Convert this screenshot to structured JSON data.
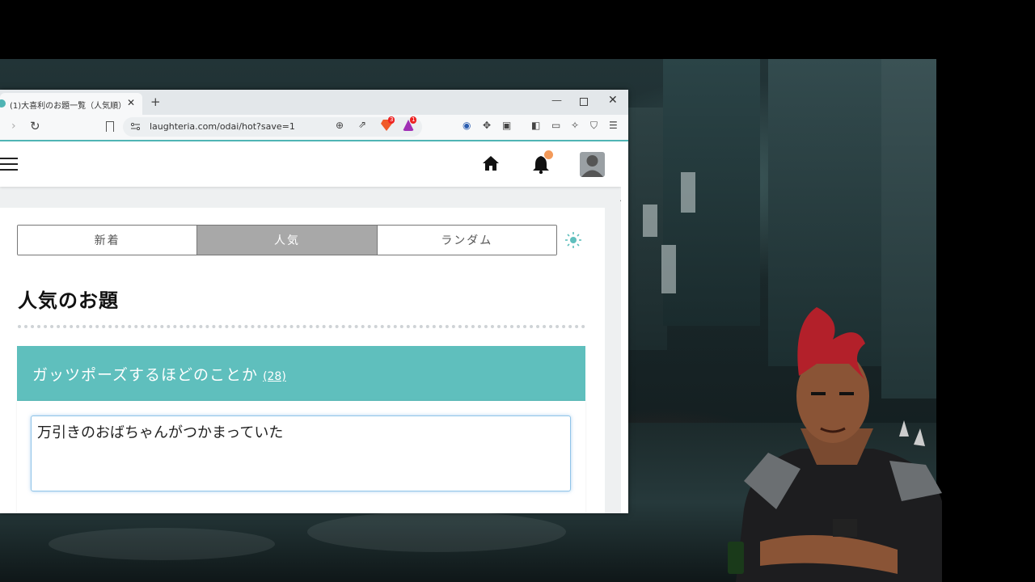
{
  "browser": {
    "tab_title": "(1)大喜利のお題一覧（人気順）",
    "tab_close": "✕",
    "new_tab": "+",
    "url": "laughteria.com/odai/hot?save=1",
    "brave_badge": "3",
    "rewards_badge": "1"
  },
  "site": {
    "nav_tabs": [
      "新着",
      "人気",
      "ランダム"
    ],
    "active_tab": "人気",
    "section_title": "人気のお題",
    "odai": {
      "title": "ガッツポーズするほどのことか",
      "count": "(28)"
    },
    "answer_value": "万引きのおばちゃんがつかまっていた"
  },
  "colors": {
    "accent": "#5fbfbd",
    "active_tab_bg": "#a8a8a8",
    "notification_dot": "#f39a5a"
  },
  "icons": [
    "menu-icon",
    "home-icon",
    "bell-icon",
    "user-avatar-icon",
    "theme-toggle-icon"
  ]
}
